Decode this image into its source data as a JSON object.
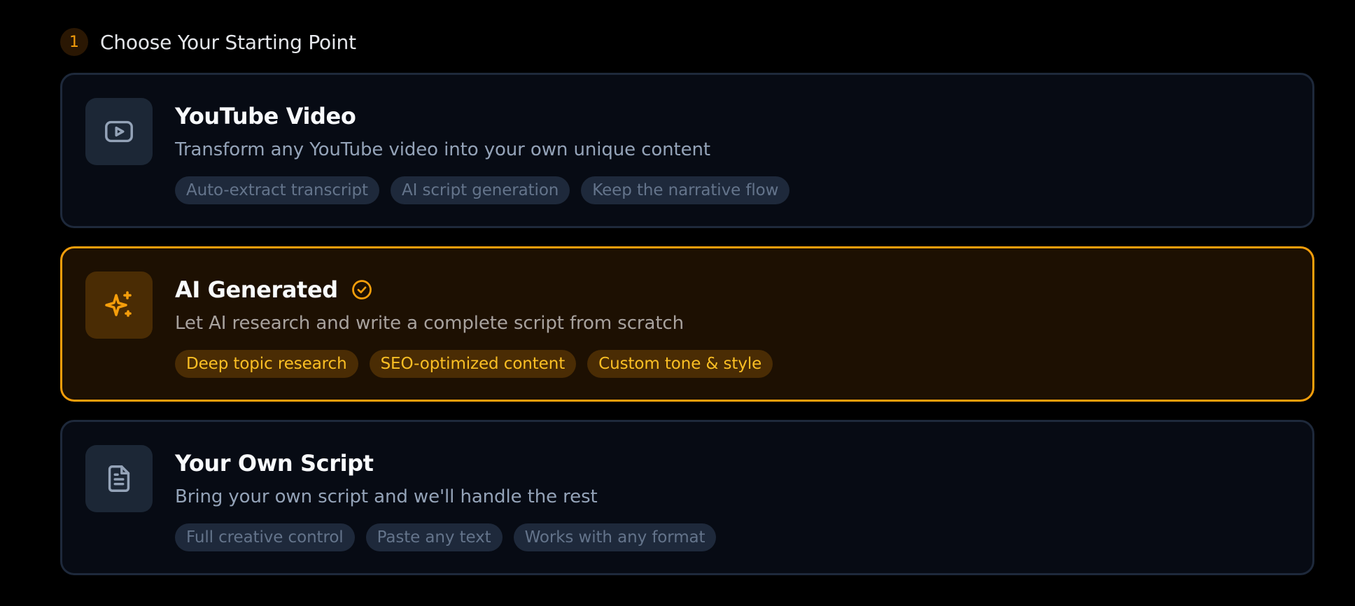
{
  "step": {
    "number": "1",
    "title": "Choose Your Starting Point"
  },
  "colors": {
    "accent": "#f59e0b",
    "background": "#000000",
    "card_background": "#070b14",
    "card_border": "#1e293b",
    "selected_background": "#1d1002"
  },
  "options": [
    {
      "title": "YouTube Video",
      "description": "Transform any YouTube video into your own unique content",
      "icon": "youtube-play-icon",
      "selected": false,
      "tags": [
        "Auto-extract transcript",
        "AI script generation",
        "Keep the narrative flow"
      ]
    },
    {
      "title": "AI Generated",
      "description": "Let AI research and write a complete script from scratch",
      "icon": "sparkles-icon",
      "selected": true,
      "tags": [
        "Deep topic research",
        "SEO-optimized content",
        "Custom tone & style"
      ]
    },
    {
      "title": "Your Own Script",
      "description": "Bring your own script and we'll handle the rest",
      "icon": "document-icon",
      "selected": false,
      "tags": [
        "Full creative control",
        "Paste any text",
        "Works with any format"
      ]
    }
  ]
}
